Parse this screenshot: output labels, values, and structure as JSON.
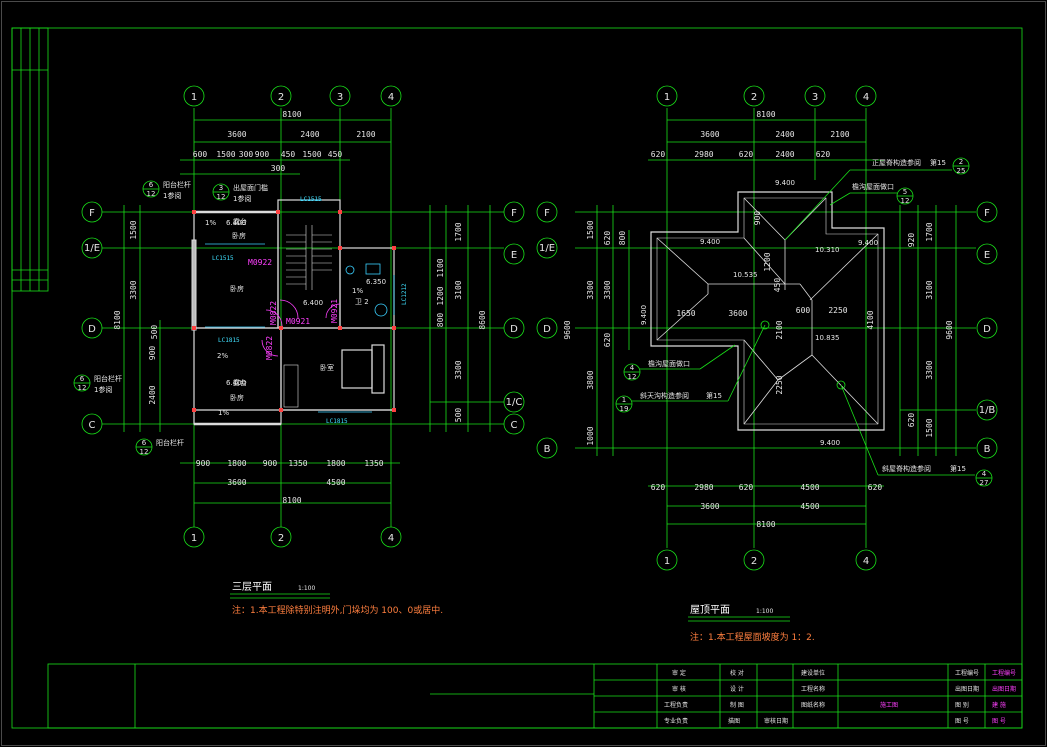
{
  "grid_bubbles_left": {
    "top": [
      "1",
      "2",
      "3",
      "4"
    ],
    "bottom": [
      "1",
      "2",
      "4"
    ],
    "left": [
      "F",
      "1/E",
      "D",
      "C"
    ],
    "right": [
      "F",
      "E",
      "D",
      "1/C",
      "C"
    ]
  },
  "grid_bubbles_right": {
    "top": [
      "1",
      "2",
      "3",
      "4"
    ],
    "bottom": [
      "1",
      "2",
      "4"
    ],
    "left": [
      "F",
      "1/E",
      "D",
      "B"
    ],
    "right": [
      "F",
      "E",
      "D",
      "1/B",
      "B"
    ]
  },
  "left_plan": {
    "dims_top_total": "8100",
    "dims_top_row1": [
      "3600",
      "2400",
      "2100"
    ],
    "dims_top_row2": [
      "600",
      "1500",
      "300",
      "900",
      "450",
      "1500",
      "450"
    ],
    "dims_top_row3": "300",
    "dims_left_total": "8100",
    "dims_left_row": [
      "1500",
      "3300",
      "900",
      "2400"
    ],
    "dims_left_inner": "500",
    "dims_right_row": [
      "1700",
      "1100",
      "1200",
      "800",
      "3100",
      "3300",
      "500"
    ],
    "dims_right_total": "8600",
    "dims_bottom_row1": [
      "900",
      "1800",
      "900",
      "1350",
      "1800",
      "1350"
    ],
    "dims_bottom_row2": [
      "3600",
      "4500"
    ],
    "dims_bottom_total": "8100",
    "callouts": [
      {
        "num": "6",
        "sub": "12",
        "text": "阳台栏杆",
        "text2": "1参阅"
      },
      {
        "num": "3",
        "sub": "12",
        "text": "出屋面门槛",
        "text2": "1参阅"
      },
      {
        "num": "6",
        "sub": "12",
        "text": "阳台栏杆",
        "text2": "1参阅"
      },
      {
        "num": "6",
        "sub": "12",
        "text": "阳台栏杆",
        "text2": ""
      }
    ],
    "room_labels": [
      "卧房",
      "卧房",
      "卧房",
      "露台",
      "露台",
      "卫 2",
      "卧室"
    ],
    "window_tags": [
      "LC1515",
      "LC1515",
      "LC1815",
      "LC1815",
      "LC1212"
    ],
    "door_tags": [
      "M0922",
      "M0921",
      "M0921",
      "M0822",
      "M0822"
    ],
    "slope_tags": [
      "1%",
      "2%",
      "1%",
      "1%"
    ],
    "elev_tags": [
      "6.400",
      "6.400",
      "6.400",
      "6.350"
    ],
    "title": "三层平面",
    "scale": "1:100",
    "note": "注：1.本工程除特别注明外,门垛均为    100、0或居中."
  },
  "right_plan": {
    "dims_top_total": "8100",
    "dims_top_row1": [
      "3600",
      "2400",
      "2100"
    ],
    "dims_top_row2": [
      "620",
      "2980",
      "620",
      "2400",
      "620"
    ],
    "dims_left_total": "9600",
    "dims_left_row": [
      "1500",
      "3300",
      "3800",
      "1000"
    ],
    "dims_left_inner": [
      "620",
      "800",
      "620"
    ],
    "dims_right_row": [
      "1700",
      "920",
      "3100",
      "3300",
      "620",
      "1500"
    ],
    "dims_right_total": "9600",
    "dims_bottom_row1": [
      "620",
      "2980",
      "620",
      "4500",
      "620"
    ],
    "dims_bottom_row2": [
      "3600",
      "4500"
    ],
    "dims_bottom_total": "8100",
    "elev_tags": [
      "9.400",
      "10.310",
      "10.535",
      "9.400",
      "9.400",
      "9.400",
      "10.835",
      "9.400"
    ],
    "inner_dims": [
      "1650",
      "3600",
      "600",
      "2250",
      "2100",
      "2250",
      "4100",
      "900",
      "1200",
      "450"
    ],
    "leaders": [
      {
        "text": "正屋脊构造参阅",
        "tail": "第15",
        "num": "2",
        "sub": "25"
      },
      {
        "text": "檐沟屋面做口",
        "tail": "",
        "num": "5",
        "sub": "12"
      },
      {
        "text": "檐沟屋面做口",
        "tail": "",
        "num": "4",
        "sub": "12"
      },
      {
        "text": "斜天沟构造参阅",
        "tail": "第15",
        "num": "1",
        "sub": "19"
      },
      {
        "text": "斜屋脊构造参阅",
        "tail": "第15",
        "num": "4",
        "sub": "27"
      }
    ],
    "title": "屋顶平面",
    "scale": "1:100",
    "note": "注：1.本工程屋面坡度为    1：2."
  },
  "title_block": {
    "col1": [
      "审 定",
      "审 核",
      "工程负责",
      "专业负责"
    ],
    "col2": [
      "校 对",
      "设 计",
      "制 图",
      "描图"
    ],
    "col3": [
      "建设单位",
      "工程名称",
      "",
      "图纸名称"
    ],
    "col4": [
      "",
      "",
      "",
      ""
    ],
    "right_labels": [
      "工程编号",
      "出图日期",
      "图 别",
      "图 号"
    ],
    "right_values": [
      "工程编号",
      "出图日期",
      "建 施",
      "图 号"
    ],
    "sheet_name": "施工图",
    "approval": "审核日期"
  }
}
